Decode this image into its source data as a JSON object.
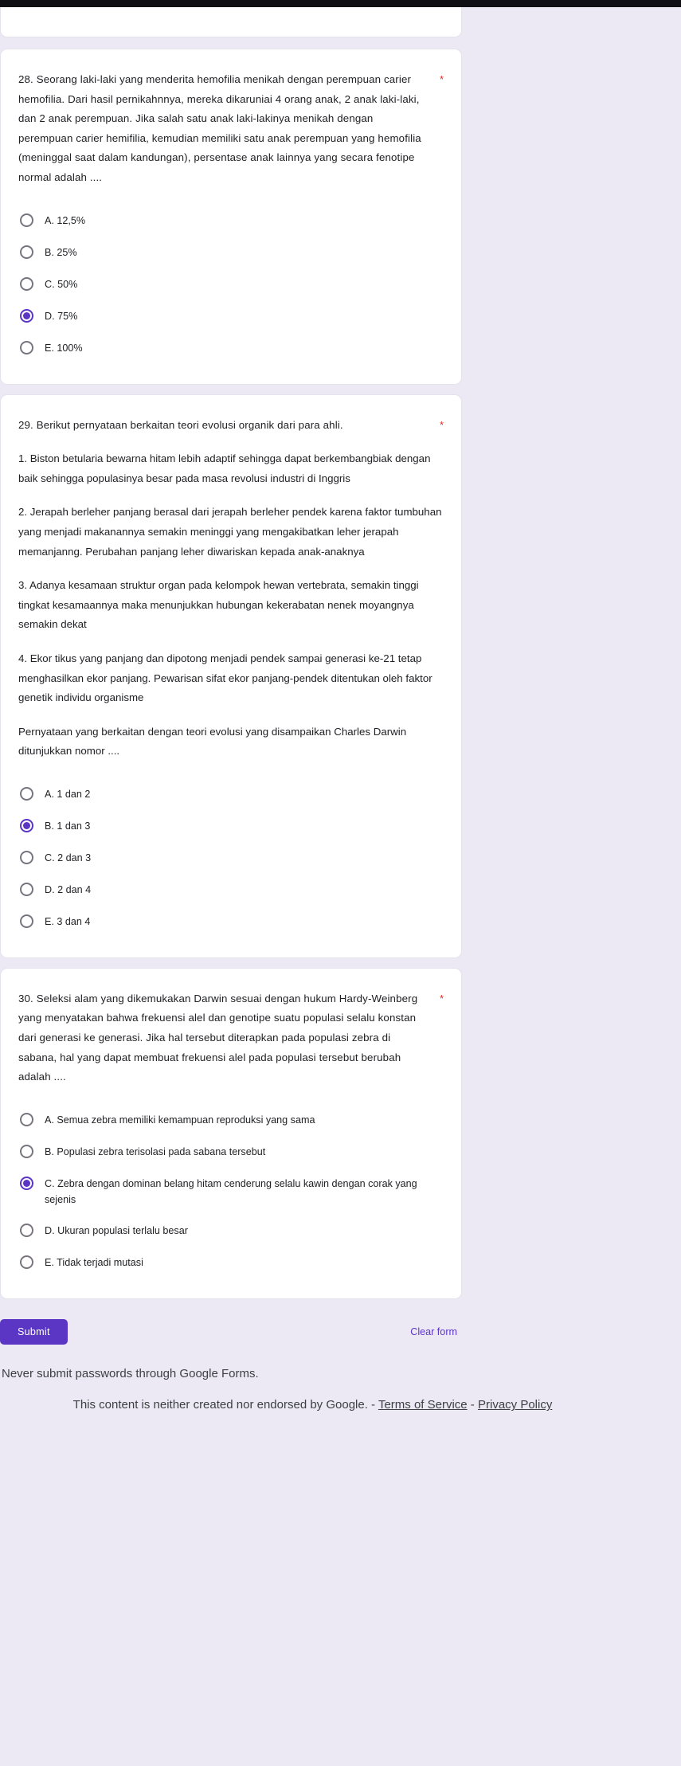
{
  "theme": {
    "background": "#ece9f5",
    "card_background": "#ffffff",
    "accent": "#5b35c4",
    "required_star_color": "#d93025",
    "text": "#202124"
  },
  "questions": [
    {
      "title": "28. Seorang laki-laki yang menderita hemofilia menikah dengan perempuan carier hemofilia. Dari hasil pernikahnnya, mereka dikaruniai 4 orang anak, 2 anak laki-laki, dan 2 anak perempuan. Jika salah satu anak laki-lakinya menikah dengan perempuan carier hemifilia, kemudian memiliki satu anak perempuan yang hemofilia (meninggal saat dalam kandungan), persentase anak lainnya yang secara fenotipe normal adalah ....",
      "required_mark": "*",
      "options": [
        {
          "label": "A. 12,5%",
          "selected": false
        },
        {
          "label": "B. 25%",
          "selected": false
        },
        {
          "label": "C. 50%",
          "selected": false
        },
        {
          "label": "D. 75%",
          "selected": true
        },
        {
          "label": "E. 100%",
          "selected": false
        }
      ]
    },
    {
      "title": "29. Berikut pernyataan berkaitan teori evolusi organik dari para ahli.",
      "required_mark": "*",
      "statements": [
        "1.    Biston betularia bewarna hitam lebih adaptif sehingga dapat berkembangbiak dengan baik sehingga populasinya besar pada masa revolusi industri di Inggris",
        "2.    Jerapah berleher panjang berasal dari jerapah berleher pendek karena faktor tumbuhan yang menjadi makanannya semakin meninggi yang mengakibatkan leher jerapah memanjanng. Perubahan panjang leher diwariskan kepada anak-anaknya",
        "3.    Adanya kesamaan struktur organ pada kelompok hewan vertebrata, semakin tinggi tingkat kesamaannya maka menunjukkan hubungan kekerabatan nenek moyangnya semakin dekat",
        "4.    Ekor tikus yang panjang dan dipotong menjadi pendek sampai generasi ke-21 tetap menghasilkan ekor panjang. Pewarisan sifat ekor panjang-pendek ditentukan oleh faktor genetik  individu organisme"
      ],
      "closing": "Pernyataan yang berkaitan dengan teori evolusi yang disampaikan Charles Darwin ditunjukkan nomor ....",
      "options": [
        {
          "label": "A. 1 dan 2",
          "selected": false
        },
        {
          "label": "B. 1 dan 3",
          "selected": true
        },
        {
          "label": "C. 2 dan 3",
          "selected": false
        },
        {
          "label": "D. 2 dan 4",
          "selected": false
        },
        {
          "label": "E. 3 dan 4",
          "selected": false
        }
      ]
    },
    {
      "title": "30.  Seleksi alam yang dikemukakan Darwin sesuai dengan hukum Hardy-Weinberg yang menyatakan bahwa frekuensi alel dan genotipe suatu populasi selalu konstan dari generasi ke generasi. Jika hal tersebut diterapkan pada populasi zebra di sabana, hal yang dapat membuat frekuensi alel pada populasi tersebut berubah adalah ....",
      "required_mark": "*",
      "options": [
        {
          "label": "A. Semua zebra memiliki kemampuan reproduksi yang sama",
          "selected": false
        },
        {
          "label": "B. Populasi zebra terisolasi pada sabana tersebut",
          "selected": false
        },
        {
          "label": "C. Zebra dengan dominan belang hitam cenderung selalu kawin dengan corak yang sejenis",
          "selected": true
        },
        {
          "label": "D. Ukuran populasi terlalu besar",
          "selected": false
        },
        {
          "label": "E. Tidak terjadi mutasi",
          "selected": false
        }
      ]
    }
  ],
  "footer": {
    "submit_label": "Submit",
    "clear_label": "Clear form",
    "password_notice": "Never submit passwords through Google Forms.",
    "legal_prefix": "This content is neither created nor endorsed by Google. - ",
    "terms_label": "Terms of Service",
    "legal_separator": " - ",
    "privacy_label": "Privacy Policy"
  }
}
